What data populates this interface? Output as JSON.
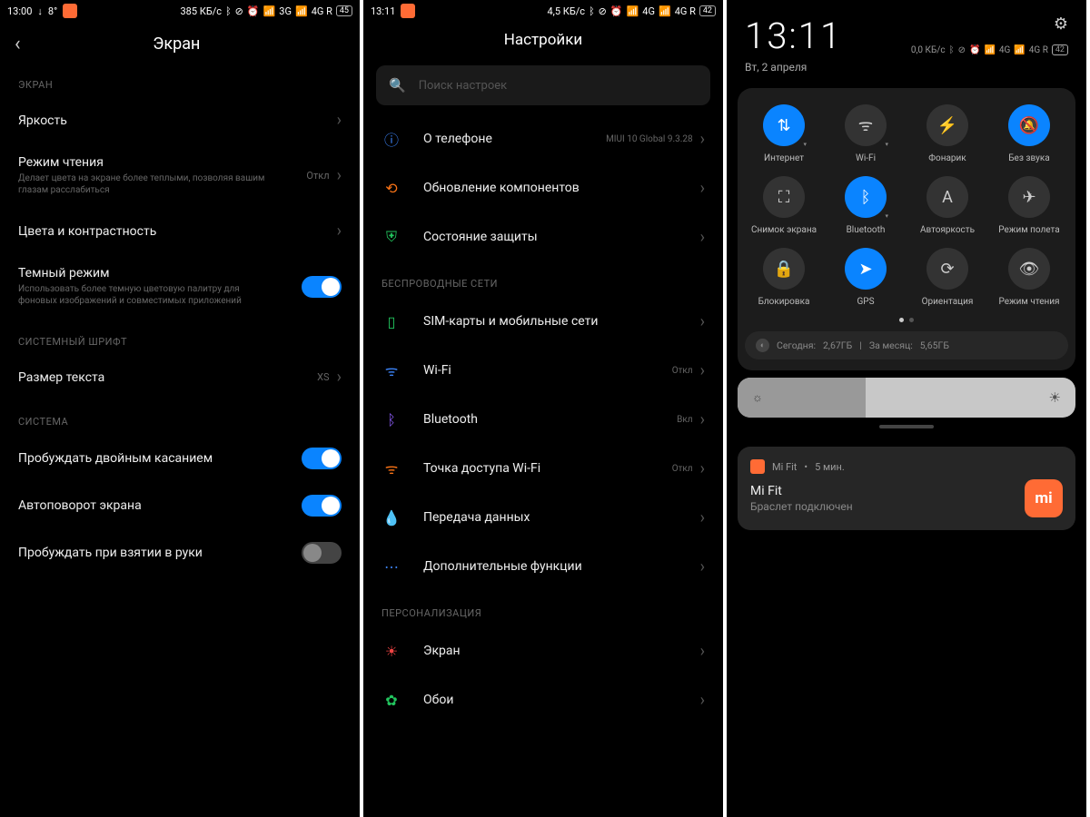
{
  "p1": {
    "status": {
      "time": "13:00",
      "dl": "↓",
      "temp": "8°",
      "speed": "385 КБ/с",
      "net1": "3G",
      "net2": "4G R",
      "batt": "45"
    },
    "title": "Экран",
    "sec1": "ЭКРАН",
    "brightness": "Яркость",
    "reading": {
      "t": "Режим чтения",
      "d": "Делает цвета на экране более теплыми, позволяя вашим глазам расслабиться",
      "v": "Откл"
    },
    "colors": "Цвета и контрастность",
    "dark": {
      "t": "Темный режим",
      "d": "Использовать более темную цветовую палитру для фоновых изображений и совместимых приложений"
    },
    "sec2": "СИСТЕМНЫЙ ШРИФТ",
    "textsize": {
      "t": "Размер текста",
      "v": "XS"
    },
    "sec3": "СИСТЕМА",
    "dtap": "Пробуждать двойным касанием",
    "autorotate": "Автоповорот экрана",
    "raise": "Пробуждать при взятии в руки"
  },
  "p2": {
    "status": {
      "time": "13:11",
      "speed": "4,5 КБ/с",
      "net1": "4G",
      "net2": "4G R",
      "batt": "42"
    },
    "title": "Настройки",
    "search_ph": "Поиск настроек",
    "about": {
      "t": "О телефоне",
      "v": "MIUI 10 Global 9.3.28"
    },
    "update": "Обновление компонентов",
    "security": "Состояние защиты",
    "sec_wireless": "БЕСПРОВОДНЫЕ СЕТИ",
    "sim": "SIM-карты и мобильные сети",
    "wifi": {
      "t": "Wi-Fi",
      "v": "Откл"
    },
    "bt": {
      "t": "Bluetooth",
      "v": "Вкл"
    },
    "hotspot": {
      "t": "Точка доступа Wi-Fi",
      "v": "Откл"
    },
    "data": "Передача данных",
    "more": "Дополнительные функции",
    "sec_personal": "ПЕРСОНАЛИЗАЦИЯ",
    "display": "Экран",
    "wallpaper": "Обои"
  },
  "p3": {
    "clock": "13:11",
    "date": "Вт, 2 апреля",
    "status": {
      "speed": "0,0 КБ/с",
      "net1": "4G",
      "net2": "4G R",
      "batt": "42"
    },
    "tiles": [
      {
        "l": "Интернет",
        "active": true,
        "i": "⇅",
        "caret": true
      },
      {
        "l": "Wi-Fi",
        "active": false,
        "i": "ᯤ",
        "caret": true
      },
      {
        "l": "Фонарик",
        "active": false,
        "i": "⚡"
      },
      {
        "l": "Без звука",
        "active": true,
        "i": "🔕"
      },
      {
        "l": "Снимок экрана",
        "active": false,
        "i": "⛶"
      },
      {
        "l": "Bluetooth",
        "active": true,
        "i": "ᛒ",
        "caret": true
      },
      {
        "l": "Автояркость",
        "active": false,
        "i": "A"
      },
      {
        "l": "Режим полета",
        "active": false,
        "i": "✈"
      },
      {
        "l": "Блокировка",
        "active": false,
        "i": "🔒"
      },
      {
        "l": "GPS",
        "active": true,
        "i": "➤"
      },
      {
        "l": "Ориентация",
        "active": false,
        "i": "⟳"
      },
      {
        "l": "Режим чтения",
        "active": false,
        "i": "👁"
      }
    ],
    "usage": {
      "today_l": "Сегодня:",
      "today_v": "2,67ГБ",
      "sep": "|",
      "month_l": "За месяц:",
      "month_v": "5,65ГБ"
    },
    "notif": {
      "app": "Mi Fit",
      "ago": "5 мин.",
      "title": "Mi Fit",
      "sub": "Браслет подключен",
      "icon_text": "mi"
    }
  }
}
